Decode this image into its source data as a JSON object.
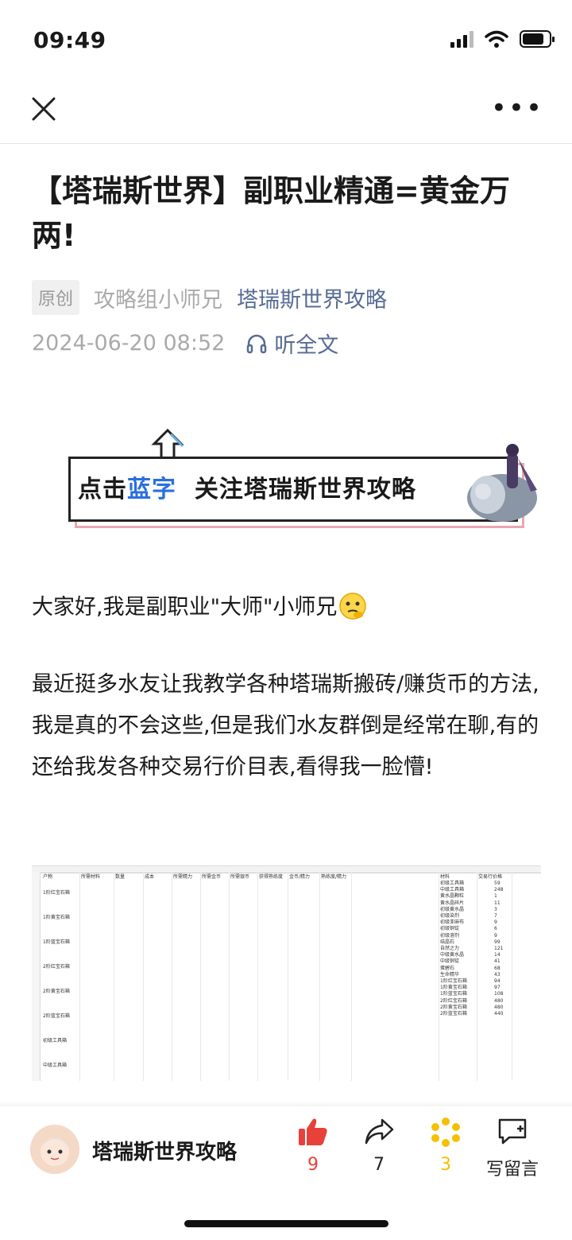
{
  "status_bar": {
    "time": "09:49"
  },
  "article": {
    "title": "【塔瑞斯世界】副职业精通=黄金万两!",
    "original_badge": "原创",
    "author": "攻略组小师兄",
    "account": "塔瑞斯世界攻略",
    "date": "2024-06-20 08:52",
    "listen_label": "听全文"
  },
  "banner": {
    "prefix": "点击",
    "highlight": "蓝字",
    "suffix": "关注塔瑞斯世界攻略"
  },
  "paragraphs": [
    "大家好,我是副职业\"大师\"小师兄",
    "最近挺多水友让我教学各种塔瑞斯搬砖/赚货币的方法,我是真的不会这些,但是我们水友群倒是经常在聊,有的还给我发各种交易行价目表,看得我一脸懵!"
  ],
  "sheet": {
    "headers": [
      "户物",
      "所需材料",
      "数量",
      "成本",
      "所需精力",
      "所需金币",
      "所需银币",
      "获得熟练度",
      "金币/精力",
      "熟练度/精力"
    ],
    "right_headers": [
      "材料",
      "交易行价格"
    ],
    "items": [
      "1阶红宝石箱",
      "1阶黄宝石箱",
      "1阶蓝宝石箱",
      "2阶红宝石箱",
      "2阶黄宝石箱",
      "2阶蓝宝石箱",
      "初级工具箱",
      "中级工具箱"
    ],
    "materials": [
      "初级工具箱",
      "中级工具箱",
      "黄水晶颗粒",
      "黄水晶碎片",
      "初级黄水晶",
      "初级染剂",
      "初级亚麻布",
      "初级铜锭",
      "初级溶剂",
      "结晶石",
      "自然之力",
      "中级黄水晶",
      "中级铜锭",
      "蛋碧石",
      "生命精华",
      "1阶红宝石箱",
      "1阶黄宝石箱",
      "1阶蓝宝石箱",
      "2阶红宝石箱",
      "2阶黄宝石箱",
      "2阶蓝宝石箱"
    ],
    "prices": [
      "59",
      "248",
      "1",
      "11",
      "3",
      "7",
      "9",
      "6",
      "9",
      "99",
      "121",
      "14",
      "41",
      "68",
      "43",
      "94",
      "97",
      "108",
      "480",
      "480",
      "440"
    ]
  },
  "bottom_bar": {
    "account": "塔瑞斯世界攻略",
    "like_count": "9",
    "share_count": "7",
    "wow_count": "3",
    "comment_label": "写留言"
  },
  "colors": {
    "link": "#576b95",
    "like": "#e8413a",
    "wow": "#f5c000",
    "banner_blue": "#2b6fe0"
  }
}
